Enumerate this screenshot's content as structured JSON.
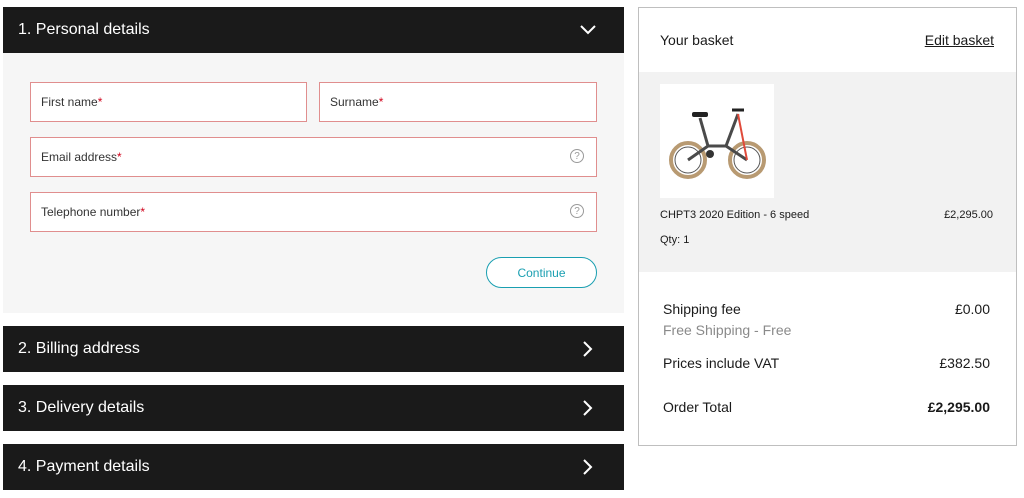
{
  "sections": {
    "personal": {
      "label": "1. Personal details"
    },
    "billing": {
      "label": "2. Billing address"
    },
    "delivery": {
      "label": "3. Delivery details"
    },
    "payment": {
      "label": "4. Payment details"
    }
  },
  "form": {
    "first_name_label": "First name",
    "surname_label": "Surname",
    "email_label": "Email address",
    "telephone_label": "Telephone number",
    "required_marker": "*",
    "help_glyph": "?",
    "continue_label": "Continue"
  },
  "basket": {
    "title": "Your basket",
    "edit_label": "Edit basket",
    "item": {
      "name": "CHPT3 2020 Edition - 6 speed",
      "price": "£2,295.00",
      "qty": "Qty: 1"
    },
    "shipping_label": "Shipping fee",
    "shipping_value": "£0.00",
    "shipping_note": "Free Shipping - Free",
    "vat_label": "Prices include VAT",
    "vat_value": "£382.50",
    "total_label": "Order Total",
    "total_value": "£2,295.00"
  },
  "icons": {
    "expanded": "chevron-down-icon",
    "collapsed": "chevron-right-icon",
    "help": "help-icon"
  },
  "colors": {
    "bar": "#1a1a1a",
    "field_border": "#e08e8e",
    "required": "#d0021b",
    "accent": "#1a9fb1"
  }
}
